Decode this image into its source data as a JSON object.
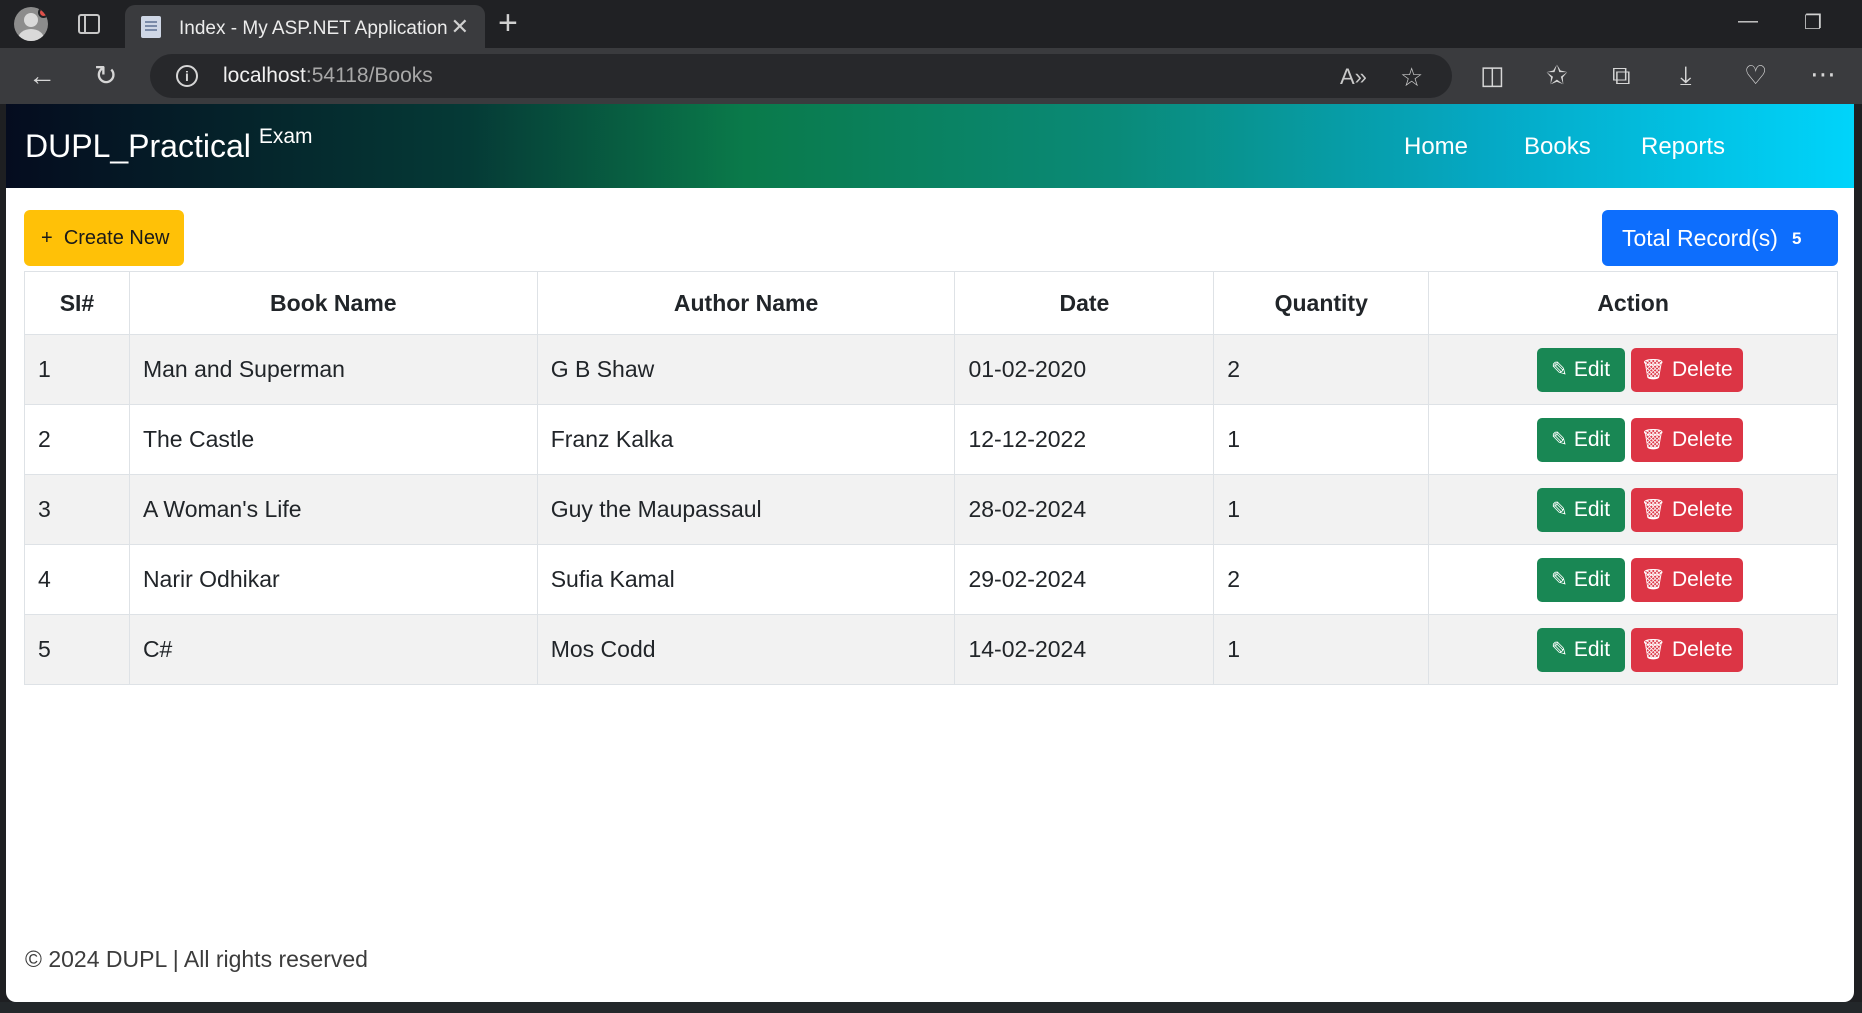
{
  "browser": {
    "tab_title": "Index - My ASP.NET Application",
    "url_host": "localhost",
    "url_path": ":54118/Books"
  },
  "navbar": {
    "brand": "DUPL_Practical",
    "brand_sup": "Exam",
    "links": [
      "Home",
      "Books",
      "Reports"
    ]
  },
  "actions": {
    "create_label": "Create New",
    "create_icon": "+",
    "total_label": "Total Record(s)",
    "total_count": "5"
  },
  "table": {
    "headers": [
      "SI#",
      "Book Name",
      "Author Name",
      "Date",
      "Quantity",
      "Action"
    ],
    "rows": [
      {
        "si": "1",
        "book": "Man and Superman",
        "author": "G B Shaw",
        "date": "01-02-2020",
        "qty": "2"
      },
      {
        "si": "2",
        "book": "The Castle",
        "author": "Franz Kalka",
        "date": "12-12-2022",
        "qty": "1"
      },
      {
        "si": "3",
        "book": "A Woman's Life",
        "author": "Guy the Maupassaul",
        "date": "28-02-2024",
        "qty": "1"
      },
      {
        "si": "4",
        "book": "Narir Odhikar",
        "author": "Sufia Kamal",
        "date": "29-02-2024",
        "qty": "2"
      },
      {
        "si": "5",
        "book": "C#",
        "author": "Mos Codd",
        "date": "14-02-2024",
        "qty": "1"
      }
    ],
    "edit_label": "Edit",
    "delete_label": "Delete"
  },
  "footer": {
    "text": "© 2024 DUPL | All rights reserved"
  },
  "colors": {
    "create_button": "#ffc107",
    "total_button": "#0d6efd",
    "edit_button": "#198754",
    "delete_button": "#dc3545"
  },
  "icons": {
    "edit": "pencil-icon",
    "delete": "trash-icon",
    "create": "plus-icon"
  }
}
